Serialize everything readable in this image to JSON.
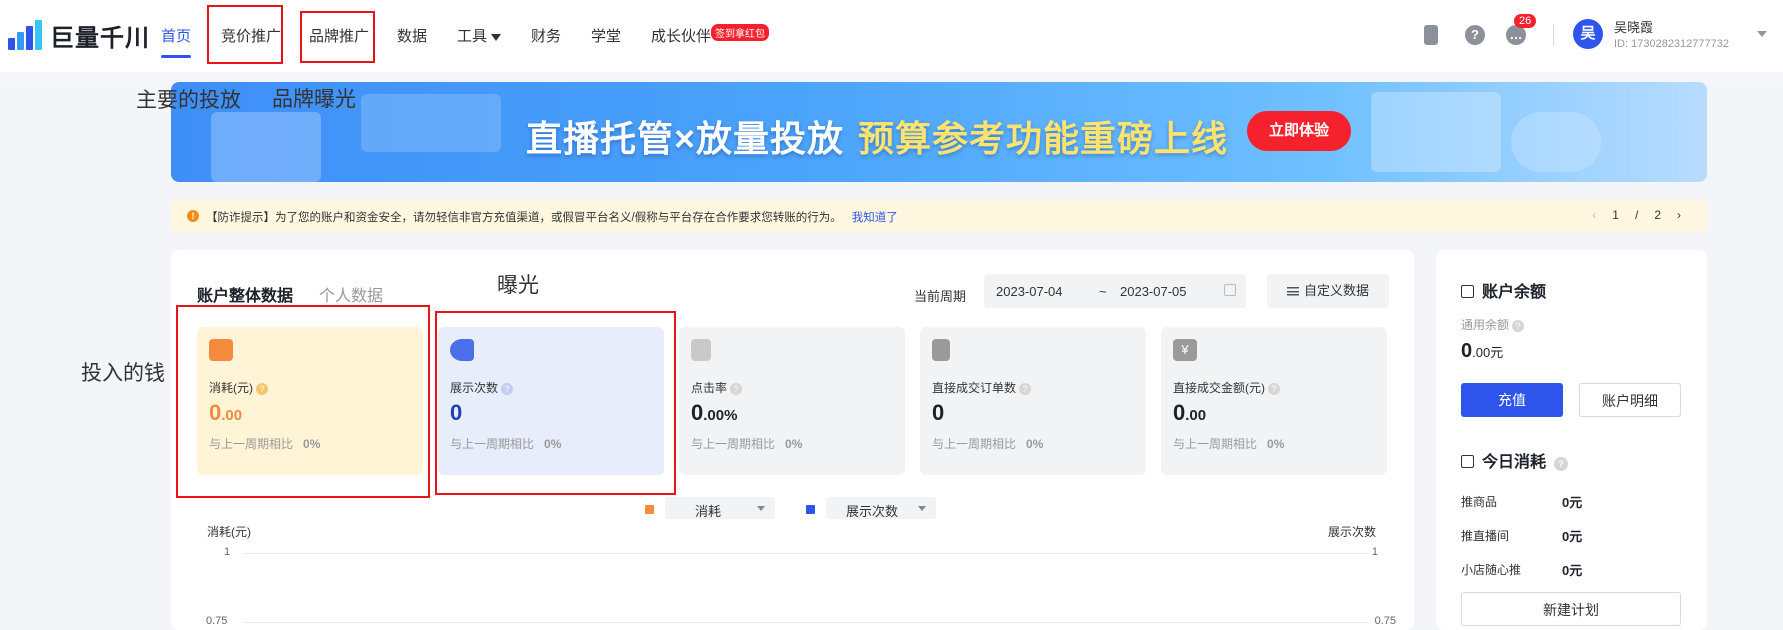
{
  "header": {
    "logo_text": "巨量千川",
    "nav": [
      {
        "label": "首页",
        "active": true
      },
      {
        "label": "竞价推广"
      },
      {
        "label": "品牌推广"
      },
      {
        "label": "数据"
      },
      {
        "label": "工具"
      },
      {
        "label": "财务"
      },
      {
        "label": "学堂"
      },
      {
        "label": "成长伙伴"
      }
    ],
    "growth_badge": "签到拿红包",
    "notification_count": "26",
    "user": {
      "avatar_char": "吴",
      "name": "吴晓霞",
      "id": "ID: 1730282312777732"
    },
    "icons": [
      "phone-icon",
      "help-icon",
      "message-icon"
    ]
  },
  "annotations": {
    "bidding_note": "主要的投放",
    "brand_note": "品牌曝光",
    "exposure_note": "曝光",
    "spend_note": "投入的钱"
  },
  "banner": {
    "title_main": "直播托管×放量投放",
    "title_sub": "预算参考功能重磅上线",
    "cta": "立即体验"
  },
  "notice": {
    "text": "【防诈提示】为了您的账户和资金安全，请勿轻信非官方充值渠道，或假冒平台名义/假称与平台存在合作要求您转账的行为。",
    "link": "我知道了",
    "page_current": "1",
    "page_sep": "/",
    "page_total": "2"
  },
  "overview": {
    "tabs": [
      "账户整体数据",
      "个人数据"
    ],
    "period_label": "当前周期",
    "date_start": "2023-07-04",
    "date_sep": "~",
    "date_end": "2023-07-05",
    "custom_btn": "自定义数据",
    "cards": [
      {
        "label": "消耗(元)",
        "value_int": "0",
        "value_dec": ".00",
        "cmp_label": "与上一周期相比",
        "cmp_value": "0%"
      },
      {
        "label": "展示次数",
        "value_int": "0",
        "value_dec": "",
        "cmp_label": "与上一周期相比",
        "cmp_value": "0%"
      },
      {
        "label": "点击率",
        "value_int": "0",
        "value_dec": ".00%",
        "cmp_label": "与上一周期相比",
        "cmp_value": "0%"
      },
      {
        "label": "直接成交订单数",
        "value_int": "0",
        "value_dec": "",
        "cmp_label": "与上一周期相比",
        "cmp_value": "0%"
      },
      {
        "label": "直接成交金额(元)",
        "value_int": "0",
        "value_dec": ".00",
        "cmp_label": "与上一周期相比",
        "cmp_value": "0%"
      }
    ],
    "legend": [
      {
        "name": "消耗",
        "color": "#f38a3e"
      },
      {
        "name": "展示次数",
        "color": "#2f54eb"
      }
    ],
    "y_left_title": "消耗(元)",
    "y_right_title": "展示次数",
    "ticks": [
      "1",
      "0.75"
    ]
  },
  "account": {
    "title": "账户余额",
    "general_label": "通用余额",
    "balance_int": "0",
    "balance_dec": ".00",
    "balance_unit": "元",
    "recharge": "充值",
    "detail": "账户明细"
  },
  "today": {
    "title": "今日消耗",
    "rows": [
      {
        "label": "推商品",
        "value": "0元"
      },
      {
        "label": "推直播间",
        "value": "0元"
      },
      {
        "label": "小店随心推",
        "value": "0元"
      }
    ],
    "new_plan": "新建计划"
  }
}
